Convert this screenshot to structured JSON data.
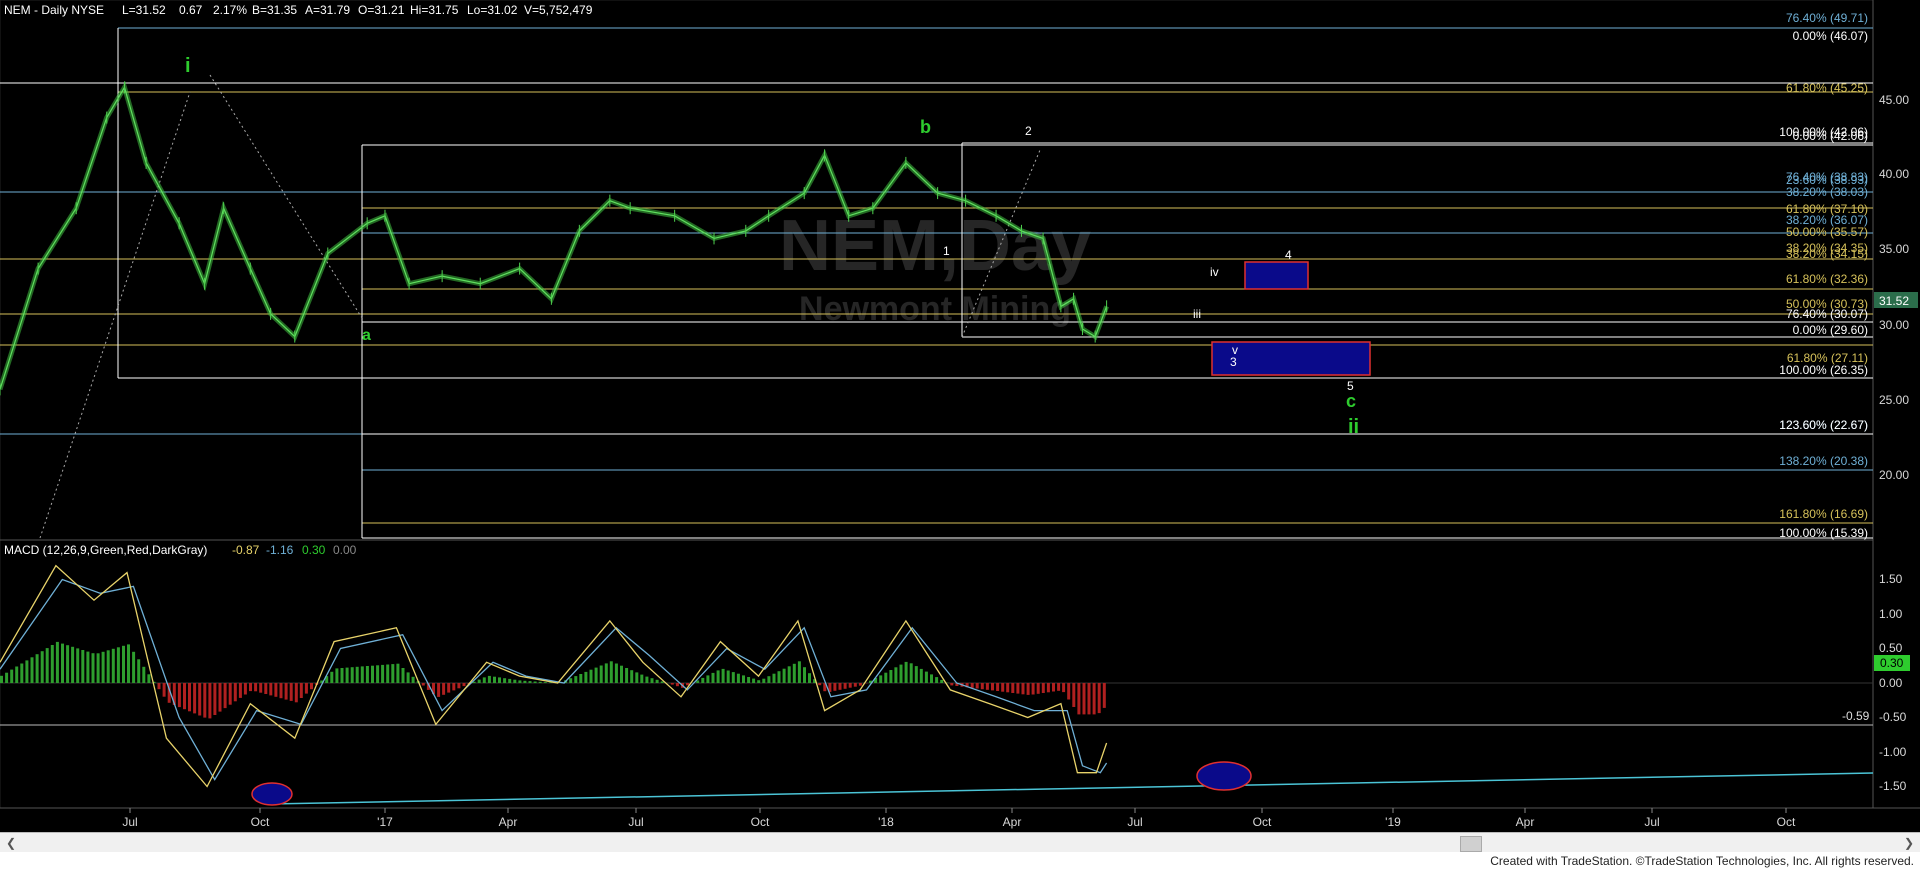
{
  "header": {
    "symbol": "NEM - Daily NYSE",
    "last": "L=31.52",
    "change": "0.67",
    "pct": "2.17%",
    "bid": "B=31.35",
    "ask": "A=31.79",
    "open": "O=31.21",
    "high": "Hi=31.75",
    "low": "Lo=31.02",
    "volume": "V=5,752,479"
  },
  "watermark": {
    "symbol": "NEM,Day",
    "name": "Newmont Mining"
  },
  "price_axis": {
    "ticks": [
      "45.00",
      "40.00",
      "35.00",
      "30.00",
      "25.00",
      "20.00"
    ],
    "last_price": "31.52",
    "last_price_color": "#2b6d4b"
  },
  "macd": {
    "label": "MACD (12,26,9,Green,Red,DarkGray)",
    "macd_val": "-0.87",
    "signal_val": "-1.16",
    "hist_val": "0.30",
    "zero_val": "0.00",
    "ticks": [
      "1.50",
      "1.00",
      "0.50",
      "0.00",
      "-0.50",
      "-1.00",
      "-1.50"
    ],
    "level_line": "-0.59",
    "last_value": "0.30"
  },
  "time_axis": {
    "labels": [
      "Jul",
      "Oct",
      "'17",
      "Apr",
      "Jul",
      "Oct",
      "'18",
      "Apr",
      "Jul",
      "Oct",
      "'19",
      "Apr",
      "Jul",
      "Oct"
    ]
  },
  "fib_labels": [
    {
      "text": "76.40% (49.71)",
      "color": "#6fb0d6"
    },
    {
      "text": "0.00% (46.07)",
      "color": "#ffffff"
    },
    {
      "text": "61.80% (45.25)",
      "color": "#d6c15a"
    },
    {
      "text": "100.00% (42.06)",
      "color": "#ffffff"
    },
    {
      "text": "0.00% (42.06)",
      "color": "#ffffff"
    },
    {
      "text": "76.40% (38.83)",
      "color": "#6fb0d6"
    },
    {
      "text": "23.60% (38.93)",
      "color": "#6fb0d6"
    },
    {
      "text": "38.20% (38.03)",
      "color": "#6fb0d6"
    },
    {
      "text": "61.80% (37.10)",
      "color": "#d6c15a"
    },
    {
      "text": "38.20% (36.07)",
      "color": "#6fb0d6"
    },
    {
      "text": "50.00% (35.57)",
      "color": "#d6c15a"
    },
    {
      "text": "38.20% (34.35)",
      "color": "#d6c15a"
    },
    {
      "text": "38.20% (34.15)",
      "color": "#d6c15a"
    },
    {
      "text": "61.80% (32.36)",
      "color": "#d6c15a"
    },
    {
      "text": "50.00% (30.73)",
      "color": "#d6c15a"
    },
    {
      "text": "76.40% (30.07)",
      "color": "#ffffff"
    },
    {
      "text": "0.00% (29.60)",
      "color": "#ffffff"
    },
    {
      "text": "61.80% (27.11)",
      "color": "#d6c15a"
    },
    {
      "text": "100.00% (26.35)",
      "color": "#ffffff"
    },
    {
      "text": "123.60% (22.67)",
      "color": "#6fb0d6"
    },
    {
      "text": "123.60% (22.67)",
      "color": "#ffffff"
    },
    {
      "text": "138.20% (20.38)",
      "color": "#6fb0d6"
    },
    {
      "text": "161.80% (16.69)",
      "color": "#d6c15a"
    },
    {
      "text": "100.00% (15.39)",
      "color": "#ffffff"
    }
  ],
  "wave_labels": {
    "green": [
      "i",
      "b",
      "a",
      "c",
      "ii"
    ],
    "white": [
      "2",
      "1",
      "iv",
      "4",
      "iii",
      "v",
      "3",
      "5"
    ]
  },
  "chart_data": {
    "type": "line",
    "title": "NEM - Daily NYSE",
    "ylim": [
      15,
      50
    ],
    "series": [
      {
        "name": "NEM",
        "x": [
          "2016-05-02",
          "2016-06-01",
          "2016-07-01",
          "2016-07-25",
          "2016-08-08",
          "2016-08-25",
          "2016-09-20",
          "2016-10-10",
          "2016-10-25",
          "2016-11-15",
          "2016-12-01",
          "2016-12-20",
          "2017-01-15",
          "2017-02-15",
          "2017-03-01",
          "2017-03-20",
          "2017-04-15",
          "2017-05-15",
          "2017-06-15",
          "2017-07-10",
          "2017-08-01",
          "2017-08-25",
          "2017-09-10",
          "2017-10-15",
          "2017-11-15",
          "2017-12-10",
          "2017-12-28",
          "2018-01-25",
          "2018-02-10",
          "2018-03-01",
          "2018-03-20",
          "2018-04-15",
          "2018-05-10",
          "2018-06-01",
          "2018-06-25",
          "2018-07-15",
          "2018-08-01",
          "2018-08-15",
          "2018-08-25",
          "2018-09-01",
          "2018-09-11",
          "2018-09-20"
        ],
        "values": [
          26.0,
          34.0,
          38.0,
          44.0,
          46.0,
          41.0,
          37.0,
          33.0,
          38.0,
          34.0,
          31.0,
          29.5,
          35.0,
          37.0,
          37.5,
          33.0,
          33.5,
          33.0,
          34.0,
          32.0,
          36.5,
          38.5,
          38.0,
          37.5,
          36.0,
          36.5,
          37.5,
          39.0,
          41.5,
          37.5,
          38.0,
          41.0,
          39.0,
          38.5,
          37.5,
          36.5,
          36.0,
          31.5,
          32.0,
          30.0,
          29.5,
          31.5
        ]
      },
      {
        "name": "MACD",
        "x": [
          "2016-05-02",
          "2016-06-15",
          "2016-07-15",
          "2016-08-10",
          "2016-09-10",
          "2016-10-12",
          "2016-11-15",
          "2016-12-20",
          "2017-01-20",
          "2017-03-10",
          "2017-04-10",
          "2017-05-20",
          "2017-06-15",
          "2017-07-15",
          "2017-08-25",
          "2017-09-20",
          "2017-10-20",
          "2017-11-20",
          "2017-12-20",
          "2018-01-20",
          "2018-02-10",
          "2018-03-10",
          "2018-04-15",
          "2018-05-20",
          "2018-06-20",
          "2018-07-20",
          "2018-08-15",
          "2018-08-28",
          "2018-09-12",
          "2018-09-20"
        ],
        "values": [
          0.3,
          1.7,
          1.2,
          1.6,
          -0.8,
          -1.5,
          -0.3,
          -0.8,
          0.6,
          0.8,
          -0.6,
          0.3,
          0.1,
          0.0,
          0.9,
          0.3,
          -0.2,
          0.6,
          0.1,
          0.9,
          -0.4,
          -0.1,
          0.9,
          -0.1,
          -0.3,
          -0.5,
          -0.3,
          -1.3,
          -1.3,
          -0.87
        ]
      },
      {
        "name": "Signal",
        "x": [
          "2016-05-02",
          "2016-06-20",
          "2016-07-20",
          "2016-08-15",
          "2016-09-20",
          "2016-10-18",
          "2016-11-20",
          "2016-12-25",
          "2017-01-25",
          "2017-03-15",
          "2017-04-15",
          "2017-05-25",
          "2017-06-20",
          "2017-07-20",
          "2017-08-30",
          "2017-09-25",
          "2017-10-25",
          "2017-11-25",
          "2017-12-25",
          "2018-01-25",
          "2018-02-15",
          "2018-03-15",
          "2018-04-20",
          "2018-05-25",
          "2018-06-25",
          "2018-07-25",
          "2018-08-20",
          "2018-09-01",
          "2018-09-15",
          "2018-09-20"
        ],
        "values": [
          0.2,
          1.5,
          1.3,
          1.4,
          -0.5,
          -1.4,
          -0.4,
          -0.6,
          0.5,
          0.7,
          -0.4,
          0.3,
          0.1,
          0.0,
          0.8,
          0.4,
          -0.1,
          0.5,
          0.2,
          0.8,
          -0.2,
          -0.1,
          0.8,
          0.0,
          -0.2,
          -0.4,
          -0.4,
          -1.2,
          -1.3,
          -1.16
        ]
      }
    ]
  }
}
